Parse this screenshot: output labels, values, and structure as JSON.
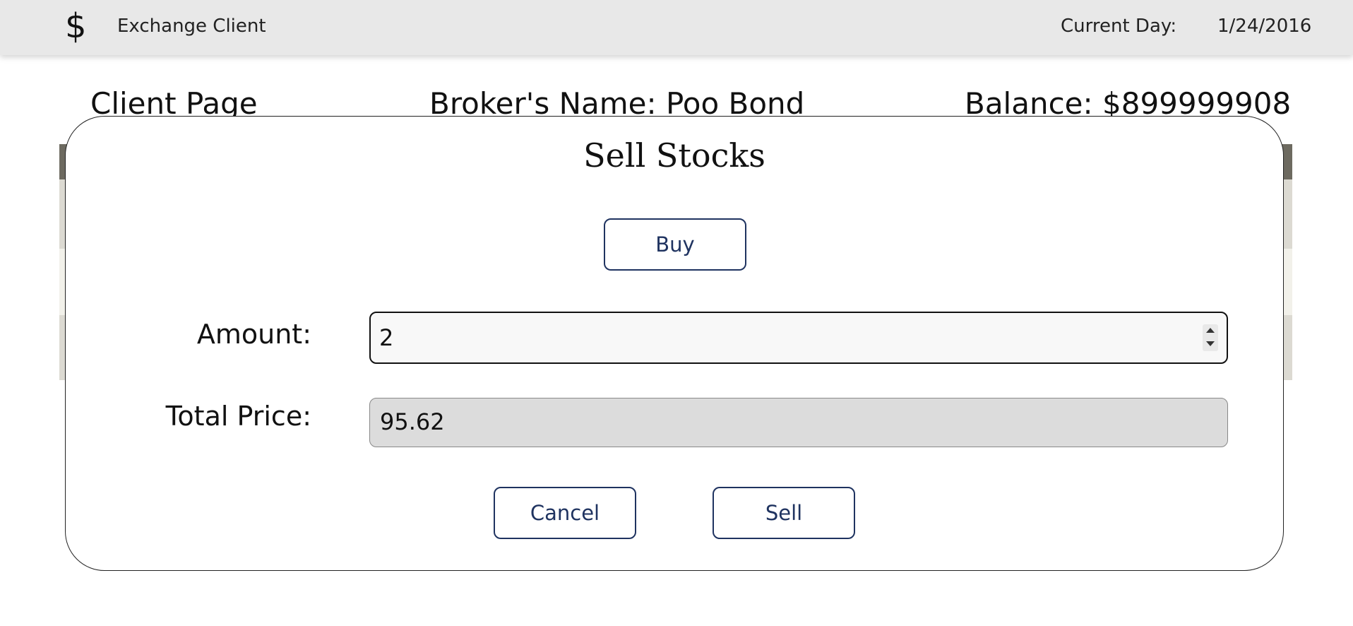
{
  "header": {
    "logo_symbol": "$",
    "app_title": "Exchange Client",
    "current_day_label": "Current Day:",
    "current_day_value": "1/24/2016"
  },
  "page": {
    "title": "Client Page",
    "broker_name": "Broker's Name: Poo Bond",
    "balance": "Balance: $899999908"
  },
  "modal": {
    "title": "Sell Stocks",
    "buy_label": "Buy",
    "amount_label": "Amount:",
    "amount_value": "2",
    "total_price_label": "Total Price:",
    "total_price_value": "95.62",
    "cancel_label": "Cancel",
    "sell_label": "Sell"
  },
  "icons": {
    "logo": "dollar-sign-icon",
    "spinner": "number-stepper-icon"
  },
  "colors": {
    "topbar_bg": "#e8e8e8",
    "button_accent": "#1f3360",
    "table_header": "#6d6a60",
    "disabled_field": "#dcdcdc"
  }
}
